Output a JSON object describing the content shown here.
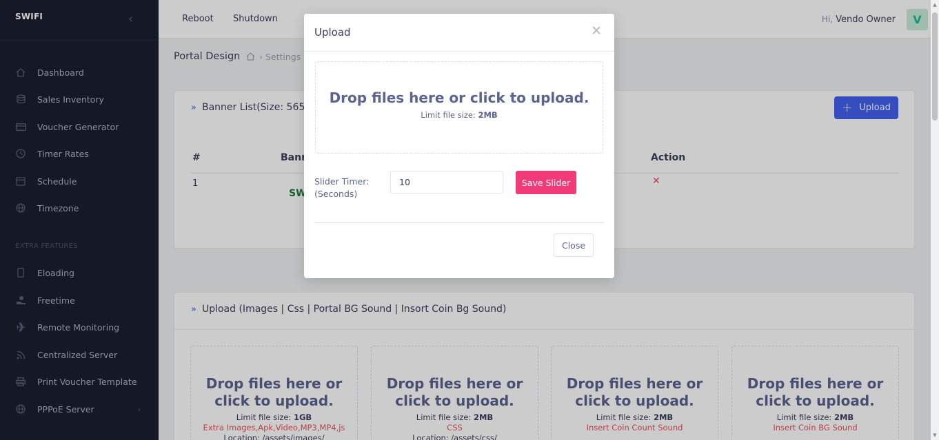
{
  "sidebar": {
    "brand": "SWIFI",
    "collapse_icon": "chevron-left-icon",
    "items": [
      {
        "label": "Dashboard",
        "icon": "home-icon"
      },
      {
        "label": "Sales Inventory",
        "icon": "database-icon"
      },
      {
        "label": "Voucher Generator",
        "icon": "credit-card-icon"
      },
      {
        "label": "Timer Rates",
        "icon": "clock-icon"
      },
      {
        "label": "Schedule",
        "icon": "calendar-icon"
      },
      {
        "label": "Timezone",
        "icon": "globe-icon"
      }
    ],
    "section_title": "EXTRA FEATURES",
    "extra_items": [
      {
        "label": "Eloading",
        "icon": "smartphone-icon"
      },
      {
        "label": "Freetime",
        "icon": "hand-coin-icon"
      },
      {
        "label": "Remote Monitoring",
        "icon": "airplane-icon"
      },
      {
        "label": "Centralized Server",
        "icon": "rss-icon"
      },
      {
        "label": "Print Voucher Template",
        "icon": "printer-icon"
      },
      {
        "label": "PPPoE Server",
        "icon": "globe-icon"
      }
    ]
  },
  "topbar": {
    "links": [
      "Reboot",
      "Shutdown"
    ],
    "greeting": "Hi,",
    "user_name": "Vendo Owner",
    "avatar_initial": "V"
  },
  "breadcrumb": {
    "title": "Portal Design",
    "path": "› Settings ›"
  },
  "banner_panel": {
    "title": "Banner List(Size: 565",
    "upload_label": "Upload",
    "columns": [
      "#",
      "Bann",
      "Action"
    ],
    "rows": [
      {
        "index": "1",
        "banner": "SW"
      }
    ]
  },
  "upload_panel": {
    "title": "Upload (Images | Css | Portal BG Sound | Insort Coin Bg Sound)",
    "boxes": [
      {
        "dz_line1": "Drop files here or",
        "dz_line2": "click to upload.",
        "limit_prefix": "Limit file size: ",
        "limit": "1GB",
        "types": "Extra Images,Apk,Video,MP3,MP4,js",
        "location": "Location: /assets/images/"
      },
      {
        "dz_line1": "Drop files here or",
        "dz_line2": "click to upload.",
        "limit_prefix": "Limit file size: ",
        "limit": "2MB",
        "types": "CSS",
        "location": "Location: /assets/css/"
      },
      {
        "dz_line1": "Drop files here or",
        "dz_line2": "click to upload.",
        "limit_prefix": "Limit file size: ",
        "limit": "2MB",
        "types": "Insert Coin Count Sound",
        "location": ""
      },
      {
        "dz_line1": "Drop files here or",
        "dz_line2": "click to upload.",
        "limit_prefix": "Limit file size: ",
        "limit": "2MB",
        "types": "Insert Coin BG Sound",
        "location": ""
      }
    ]
  },
  "modal": {
    "title": "Upload",
    "dropzone_text": "Drop files here or click to upload.",
    "limit_prefix": "Limit file size: ",
    "limit": "2MB",
    "slider_label_1": "Slider Timer:",
    "slider_label_2": "(Seconds)",
    "slider_value": "10",
    "save_label": "Save Slider",
    "close_label": "Close"
  },
  "colors": {
    "sidebar_bg": "#1b1e2f",
    "primary": "#4361ee",
    "pink": "#f03b78",
    "danger": "#e7515a"
  }
}
